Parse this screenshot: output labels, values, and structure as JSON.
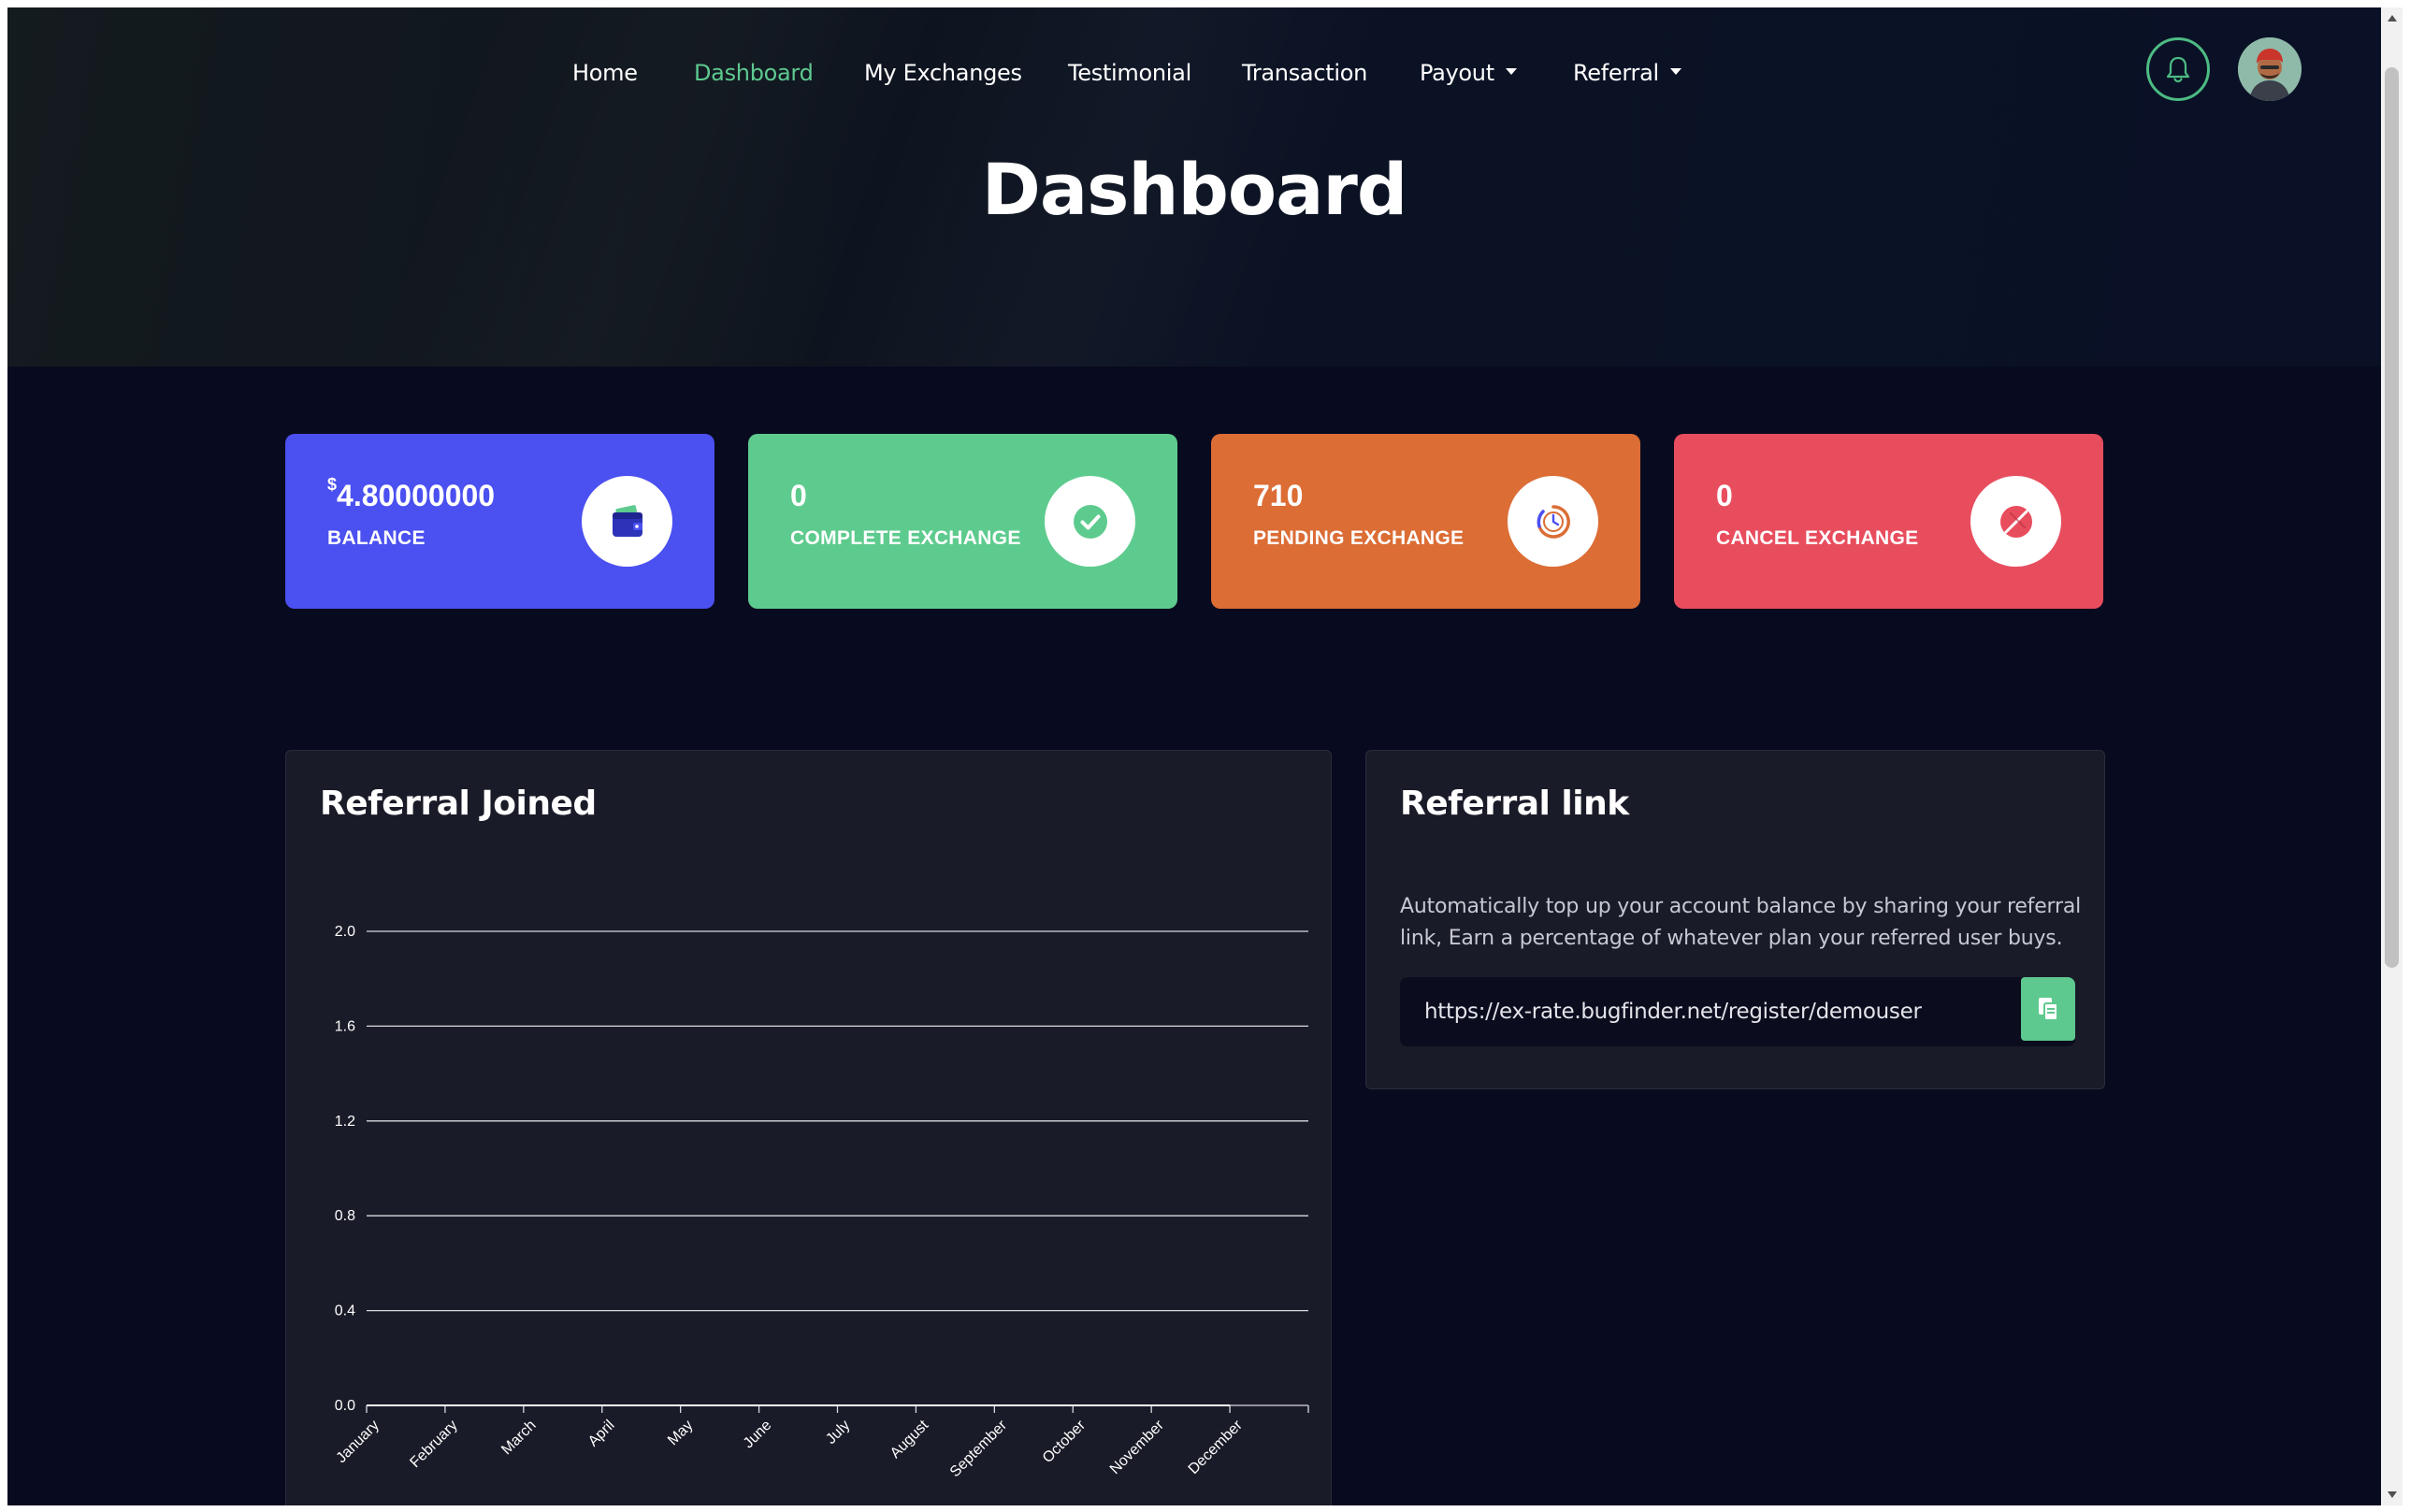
{
  "nav": {
    "items": [
      {
        "label": "Home",
        "active": false,
        "dropdown": false
      },
      {
        "label": "Dashboard",
        "active": true,
        "dropdown": false
      },
      {
        "label": "My Exchanges",
        "active": false,
        "dropdown": false
      },
      {
        "label": "Testimonial",
        "active": false,
        "dropdown": false
      },
      {
        "label": "Transaction",
        "active": false,
        "dropdown": false
      },
      {
        "label": "Payout",
        "active": false,
        "dropdown": true
      },
      {
        "label": "Referral",
        "active": false,
        "dropdown": true
      }
    ],
    "notification_icon": "bell-icon",
    "avatar_icon": "user-avatar"
  },
  "page": {
    "title": "Dashboard"
  },
  "cards": [
    {
      "currency": "$",
      "value": "4.80000000",
      "label": "BALANCE",
      "color": "#4b50f0",
      "icon": "wallet-icon"
    },
    {
      "currency": "",
      "value": "0",
      "label": "COMPLETE EXCHANGE",
      "color": "#5ecb8e",
      "icon": "check-circle-icon"
    },
    {
      "currency": "",
      "value": "710",
      "label": "PENDING EXCHANGE",
      "color": "#db6d35",
      "icon": "clock-icon"
    },
    {
      "currency": "",
      "value": "0",
      "label": "CANCEL EXCHANGE",
      "color": "#e84d5e",
      "icon": "cancel-icon"
    }
  ],
  "referral_joined": {
    "title": "Referral Joined"
  },
  "referral_link": {
    "title": "Referral link",
    "description": "Automatically top up your account balance by sharing your referral link, Earn a percentage of whatever plan your referred user buys.",
    "url": "https://ex-rate.bugfinder.net/register/demouser",
    "copy_icon": "copy-icon"
  },
  "chart_data": {
    "type": "line",
    "title": "",
    "xlabel": "",
    "ylabel": "",
    "categories": [
      "January",
      "February",
      "March",
      "April",
      "May",
      "June",
      "July",
      "August",
      "September",
      "October",
      "November",
      "December"
    ],
    "series": [
      {
        "values": [
          0,
          0,
          0,
          0,
          0,
          0,
          0,
          0,
          0,
          0,
          0,
          0
        ]
      }
    ],
    "ylim": [
      0,
      2.0
    ],
    "yticks": [
      "0.0",
      "0.4",
      "0.8",
      "1.2",
      "1.6",
      "2.0"
    ],
    "grid": true,
    "line_color": "#ffffff"
  }
}
